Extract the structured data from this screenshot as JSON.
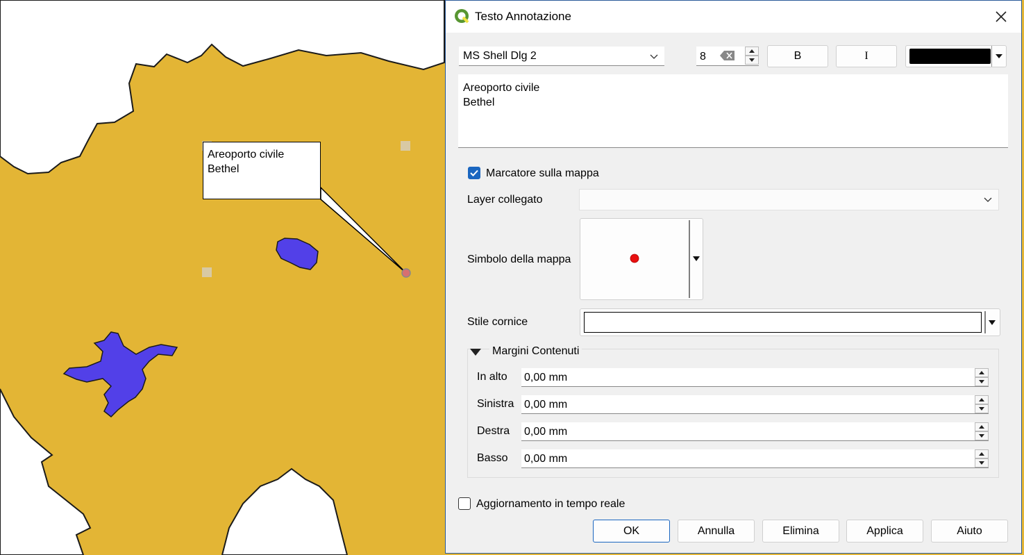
{
  "map": {
    "callout_lines": [
      "Areoporto civile",
      "Bethel"
    ],
    "colors": {
      "land": "#e3b535",
      "water": "#5240e8",
      "marker": "#e83030"
    }
  },
  "dialog": {
    "title": "Testo Annotazione",
    "font_family": "MS Shell Dlg 2",
    "font_size": "8",
    "bold_label": "B",
    "italic_label": "I",
    "text_color": "#000000",
    "text": "Areoporto civile\nBethel",
    "map_marker": {
      "label": "Marcatore sulla mappa",
      "checked": true
    },
    "linked_layer": {
      "label": "Layer collegato",
      "value": ""
    },
    "map_symbol_label": "Simbolo della mappa",
    "frame_style_label": "Stile cornice",
    "margins": {
      "title": "Margini Contenuti",
      "fields": [
        {
          "label": "In alto",
          "value": "0,00 mm"
        },
        {
          "label": "Sinistra",
          "value": "0,00 mm"
        },
        {
          "label": "Destra",
          "value": "0,00 mm"
        },
        {
          "label": "Basso",
          "value": "0,00 mm"
        }
      ]
    },
    "live_update": {
      "label": "Aggiornamento in tempo reale",
      "checked": false
    },
    "buttons": {
      "ok": "OK",
      "cancel": "Annulla",
      "delete": "Elimina",
      "apply": "Applica",
      "help": "Aiuto"
    }
  }
}
